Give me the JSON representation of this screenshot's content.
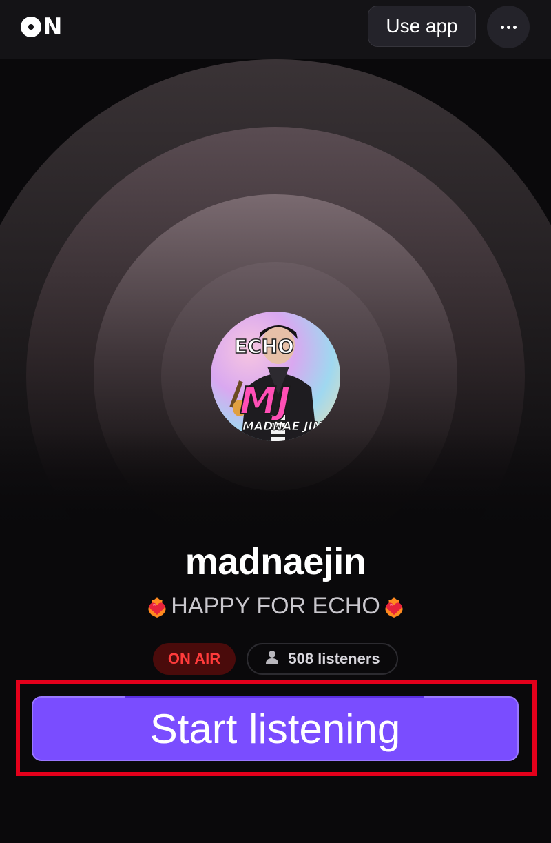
{
  "header": {
    "logo_text": "ON",
    "use_app_label": "Use app",
    "more_icon": "more-horizontal-icon"
  },
  "profile": {
    "username": "madnaejin",
    "bio": "HAPPY FOR ECHO",
    "bio_emoji": "heart-on-fire-icon",
    "avatar_text": {
      "top": "ECHO",
      "main": "MJ",
      "bottom": "MADNAE JIN"
    }
  },
  "status": {
    "on_air_label": "ON AIR",
    "listeners_label": "508 listeners",
    "listeners_icon": "person-icon"
  },
  "cta": {
    "start_label": "Start listening"
  },
  "colors": {
    "accent": "#7a4dff",
    "on_air_text": "#ff3b3b",
    "on_air_bg": "#4a0b0b",
    "highlight_frame": "#e3001b"
  }
}
